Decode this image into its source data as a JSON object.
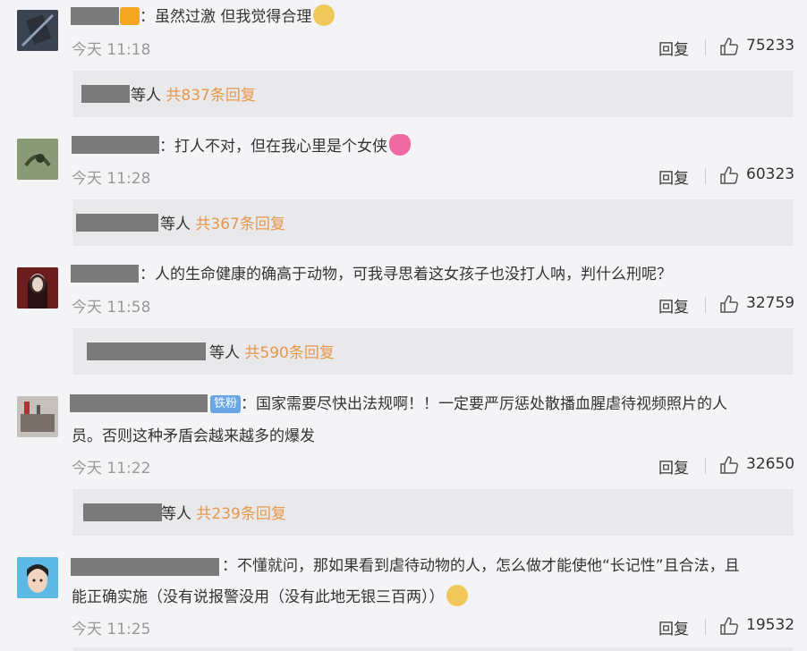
{
  "comments": [
    {
      "text": "：虽然过激 但我觉得合理",
      "time": "今天 11:18",
      "reply_label": "回复",
      "likes": "75233",
      "replies_who": "等人",
      "replies_count": "共837条回复"
    },
    {
      "text": "：打人不对，但在我心里是个女侠",
      "time": "今天 11:28",
      "reply_label": "回复",
      "likes": "60323",
      "replies_who": "等人",
      "replies_count": "共367条回复"
    },
    {
      "text": "：人的生命健康的确高于动物，可我寻思着这女孩子也没打人呐，判什么刑呢？",
      "time": "今天 11:58",
      "reply_label": "回复",
      "likes": "32759",
      "replies_who": "等人",
      "replies_count": "共590条回复"
    },
    {
      "badge": "铁粉",
      "text_line1": "：国家需要尽快出法规啊！！一定要严厉惩处散播血腥虐待视频照片的人",
      "text_line2": "员。否则这种矛盾会越来越多的爆发",
      "time": "今天 11:22",
      "reply_label": "回复",
      "likes": "32650",
      "replies_who": "等人",
      "replies_count": "共239条回复"
    },
    {
      "text_line1": "：不懂就问，那如果看到虐待动物的人，怎么做才能使他“长记性”且合法，且",
      "text_line2": "能正确实施（没有说报警没用（没有此地无银三百两））",
      "time": "今天 11:25",
      "reply_label": "回复",
      "likes": "19532"
    }
  ],
  "colors": {
    "background": "#f4f4f6",
    "reply_count": "#e5974b",
    "timestamp": "#999999",
    "badge": "#69a6e6",
    "redaction": "#7b7b7b"
  },
  "icons": [
    "thumbs-up-icon",
    "dog-emoji-icon",
    "heart-emoji-icon"
  ]
}
